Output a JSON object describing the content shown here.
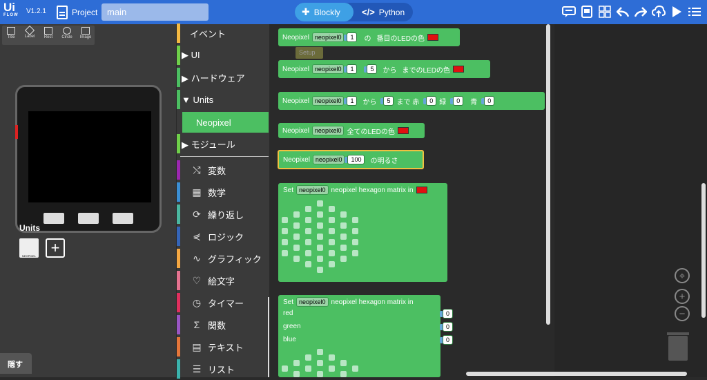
{
  "app": {
    "logo": "Ui",
    "logo_sub": "FLOW",
    "version": "V1.2.1",
    "project_label": "Project",
    "filename": "main"
  },
  "modes": {
    "blockly": "Blockly",
    "python": "Python"
  },
  "toolbar_icons": [
    "chat-icon",
    "device-icon",
    "layout-icon",
    "undo-icon",
    "redo-icon",
    "cloud-icon",
    "run-icon",
    "menu-icon"
  ],
  "tools": [
    {
      "label": "Title"
    },
    {
      "label": "Label"
    },
    {
      "label": "Rect"
    },
    {
      "label": "Circle"
    },
    {
      "label": "Image"
    }
  ],
  "units": {
    "title": "Units",
    "neopixel_badge": "NEOPIXEL"
  },
  "hide_label": "隠す",
  "categories": [
    {
      "label": "イベント",
      "color": "#f4b942"
    },
    {
      "label": "▶ UI",
      "color": "#6fd04a"
    },
    {
      "label": "▶ ハードウェア",
      "color": "#4cbf62"
    },
    {
      "label": "▼ Units",
      "color": "#4cbf62"
    },
    {
      "label": "Neopixel",
      "color": "#4cbf62"
    },
    {
      "label": "▶ モジュール",
      "color": "#6fd04a"
    },
    {
      "label": "変数",
      "color": "#9c27b0",
      "icon": "⤭"
    },
    {
      "label": "数学",
      "color": "#3b8fd4",
      "icon": "▦"
    },
    {
      "label": "繰り返し",
      "color": "#4bb7a0",
      "icon": "⟳"
    },
    {
      "label": "ロジック",
      "color": "#3565b8",
      "icon": "⋞"
    },
    {
      "label": "グラフィック",
      "color": "#f4a742",
      "icon": "∿"
    },
    {
      "label": "絵文字",
      "color": "#e57390",
      "icon": "♡"
    },
    {
      "label": "タイマー",
      "color": "#e02f5e",
      "icon": "◷"
    },
    {
      "label": "関数",
      "color": "#9a56c4",
      "icon": "Σ"
    },
    {
      "label": "テキスト",
      "color": "#e5763a",
      "icon": "▤"
    },
    {
      "label": "リスト",
      "color": "#3bb3ad",
      "icon": "☰"
    }
  ],
  "blocks": {
    "b1": {
      "title": "Neopixel",
      "dd": "neopixel0",
      "n1": "1",
      "t1": "の",
      "t2": "番目のLEDの色"
    },
    "setup": "Setup",
    "b2": {
      "title": "Neopixel",
      "dd": "neopixel0",
      "n1": "1",
      "n2": "5",
      "t1": "から",
      "t2": "までのLEDの色"
    },
    "b3": {
      "title": "Neopixel",
      "dd": "neopixel0",
      "n1": "1",
      "t1": "から",
      "n2": "5",
      "t2": "まで 赤",
      "n3": "0",
      "t3": "緑",
      "n4": "0",
      "t4": "青",
      "n5": "0"
    },
    "b4": {
      "title": "Neopixel",
      "dd": "neopixel0",
      "t1": "全てのLEDの色"
    },
    "b5": {
      "title": "Neopixel",
      "dd": "neopixel0",
      "n1": "100",
      "t1": "の明るさ"
    },
    "b6": {
      "title": "Set",
      "dd": "neopixel0",
      "t1": "neopixel hexagon matrix in"
    },
    "b7": {
      "title": "Set",
      "dd": "neopixel0",
      "t1": "neopixel hexagon matrix in",
      "red": "red",
      "green": "green",
      "blue": "blue",
      "rv": "0",
      "gv": "0",
      "bv": "0"
    }
  },
  "colors": {
    "topbar": "#2e6dd6",
    "block": "#4cbf62",
    "red": "#e01010"
  }
}
